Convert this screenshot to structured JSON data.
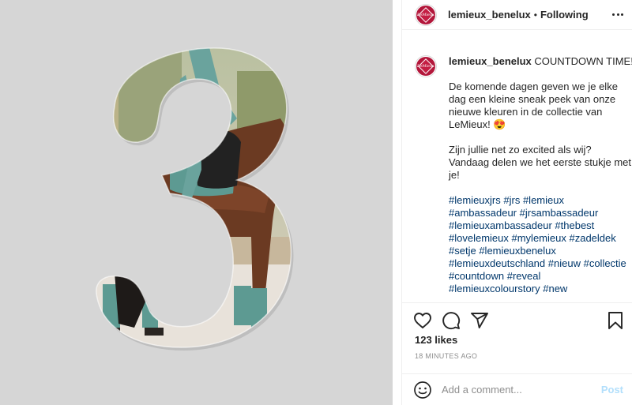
{
  "colors": {
    "brand": "#b3173b",
    "link": "#00376b",
    "post_disabled": "#b2dffc",
    "muted": "#8e8e8e"
  },
  "media": {
    "background": "#d6d6d6",
    "subject": "riding"
  },
  "header": {
    "username": "lemieux_benelux",
    "separator": "•",
    "follow_status": "Following",
    "more_icon": "more-horizontal-icon"
  },
  "caption": {
    "username": "lemieux_benelux",
    "title": "COUNTDOWN TIME!",
    "paragraph1": "De komende dagen geven we je elke dag een kleine sneak peek van onze nieuwe kleuren in de collectie van LeMieux! 😍",
    "paragraph2": "Zijn jullie net zo excited als wij? Vandaag delen we het eerste stukje met je!",
    "hashtags": [
      "#lemieuxjrs",
      "#jrs",
      "#lemieux",
      "#ambassadeur",
      "#jrsambassadeur",
      "#lemieuxambassadeur",
      "#thebest",
      "#lovelemieux",
      "#mylemieux",
      "#zadeldek",
      "#setje",
      "#lemieuxbenelux",
      "#lemieuxdeutschland",
      "#nieuw",
      "#collectie",
      "#countdown",
      "#reveal",
      "#lemieuxcolourstory",
      "#new"
    ]
  },
  "actions": {
    "like_icon": "heart-icon",
    "comment_icon": "comment-icon",
    "share_icon": "share-icon",
    "save_icon": "bookmark-icon",
    "likes": "123 likes",
    "timestamp": "18 MINUTES AGO"
  },
  "comment_box": {
    "placeholder": "Add a comment...",
    "value": "",
    "post_label": "Post",
    "emoji_icon": "emoji-icon"
  }
}
